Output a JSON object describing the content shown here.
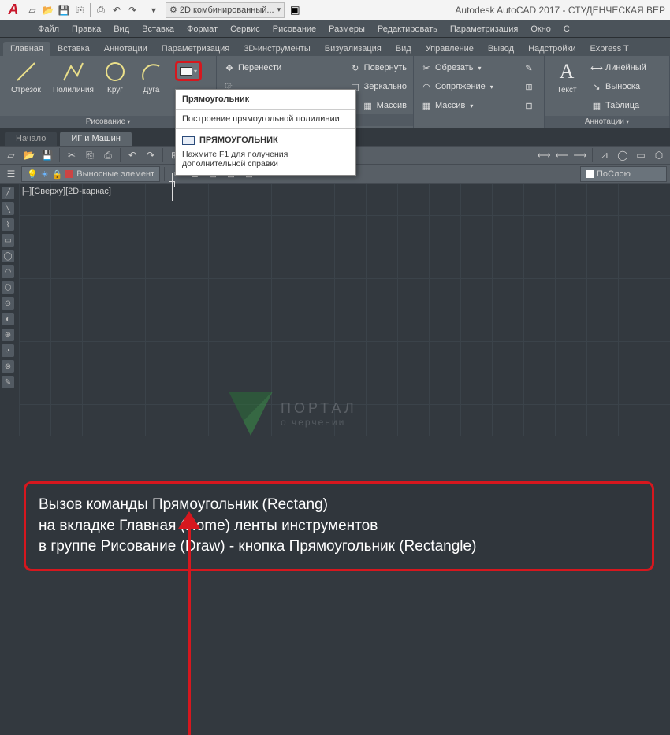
{
  "app": {
    "title": "Autodesk AutoCAD 2017 - СТУДЕНЧЕСКАЯ ВЕР"
  },
  "workspace": {
    "label": "2D комбинированный..."
  },
  "menu": {
    "items": [
      "Файл",
      "Правка",
      "Вид",
      "Вставка",
      "Формат",
      "Сервис",
      "Рисование",
      "Размеры",
      "Редактировать",
      "Параметризация",
      "Окно",
      "С"
    ]
  },
  "ribbonTabs": [
    "Главная",
    "Вставка",
    "Аннотации",
    "Параметризация",
    "3D-инструменты",
    "Визуализация",
    "Вид",
    "Управление",
    "Вывод",
    "Надстройки",
    "Express T"
  ],
  "drawPanel": {
    "title": "Рисование",
    "btns": {
      "line": "Отрезок",
      "polyline": "Полилиния",
      "circle": "Круг",
      "arc": "Дуга"
    }
  },
  "modifyPanel": {
    "rows": {
      "move": "Перенести",
      "rotate": "Повернуть",
      "trim": "Обрезать",
      "mirror": "Зеркально",
      "fillet": "Сопряжение",
      "array": "Массив"
    }
  },
  "annoPanel": {
    "title": "Аннотации",
    "text": "Текст",
    "rows": {
      "linear": "Линейный",
      "leader": "Выноска",
      "table": "Таблица"
    }
  },
  "tooltip": {
    "head": "Прямоугольник",
    "sub": "Построение прямоугольной полилинии",
    "title2": "ПРЯМОУГОЛЬНИК",
    "hint": "Нажмите F1 для получения дополнительной справки"
  },
  "docTabs": {
    "start": "Начало",
    "active": "ИГ и Машин"
  },
  "layers": {
    "current": "Выносные элемент",
    "bylayer": "ПоСлою"
  },
  "viewport": {
    "label": "[–][Сверху][2D-каркас]"
  },
  "watermark": {
    "main": "ПОРТАЛ",
    "sub": "о черчении"
  },
  "instruction": {
    "l1": "Вызов команды Прямоугольник (Rectang)",
    "l2": "на вкладке Главная (Home) ленты инструментов",
    "l3": "в группе Рисование (Draw) - кнопка Прямоугольник (Rectangle)"
  }
}
